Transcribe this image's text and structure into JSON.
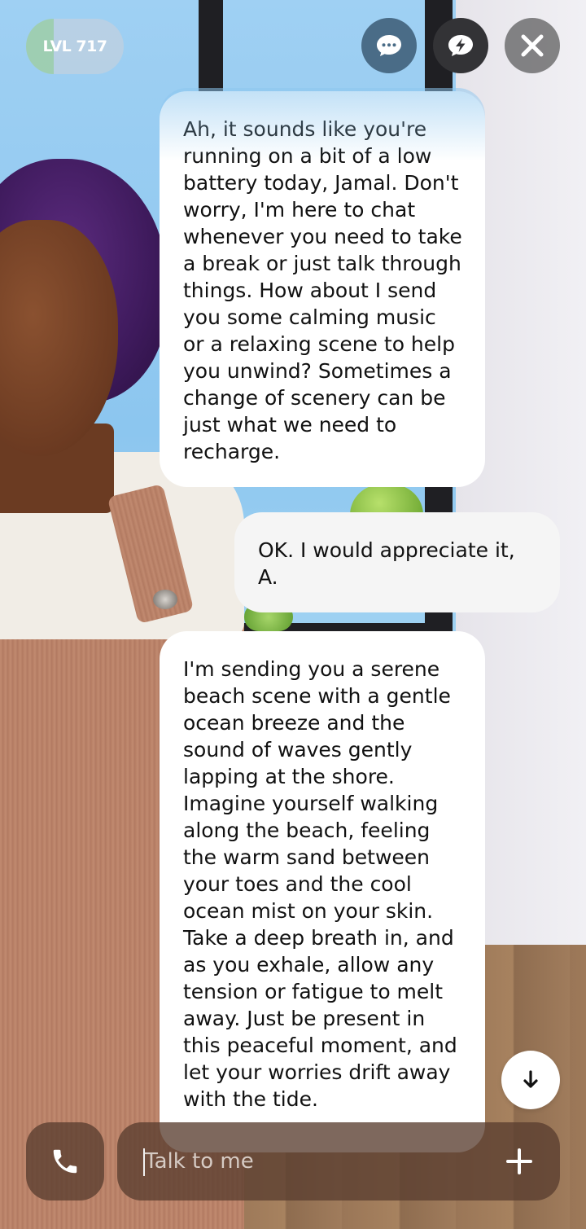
{
  "level": {
    "label": "LVL 717",
    "progress_fraction": 0.28
  },
  "top_actions": [
    {
      "name": "chat-mode",
      "icon": "chat-bubble-icon"
    },
    {
      "name": "quick-action",
      "icon": "lightning-bubble-icon"
    },
    {
      "name": "close",
      "icon": "close-icon"
    }
  ],
  "messages": [
    {
      "sender": "ai",
      "text": "Ah, it sounds like you're running on a bit of a low battery today, Jamal. Don't worry, I'm here to chat whenever you need to take a break or just talk through things. How about I send you some calming music or a relaxing scene to help you unwind? Sometimes a change of scenery can be just what we need to recharge."
    },
    {
      "sender": "user",
      "text": "OK. I would appreciate it, A."
    },
    {
      "sender": "ai",
      "text": "I'm sending you a serene beach scene with a gentle ocean breeze and the sound of waves gently lapping at the shore. Imagine yourself walking along the beach, feeling the warm sand between your toes and the cool ocean mist on your skin. Take a deep breath in, and as you exhale, allow any tension or fatigue to melt away. Just be present in this peaceful moment, and let your worries drift away with the tide."
    }
  ],
  "composer": {
    "placeholder": "Talk to me",
    "value": ""
  },
  "colors": {
    "chat_button": "#4a6c87",
    "bubble": "#ffffff",
    "input_bg": "#5a3e30"
  }
}
